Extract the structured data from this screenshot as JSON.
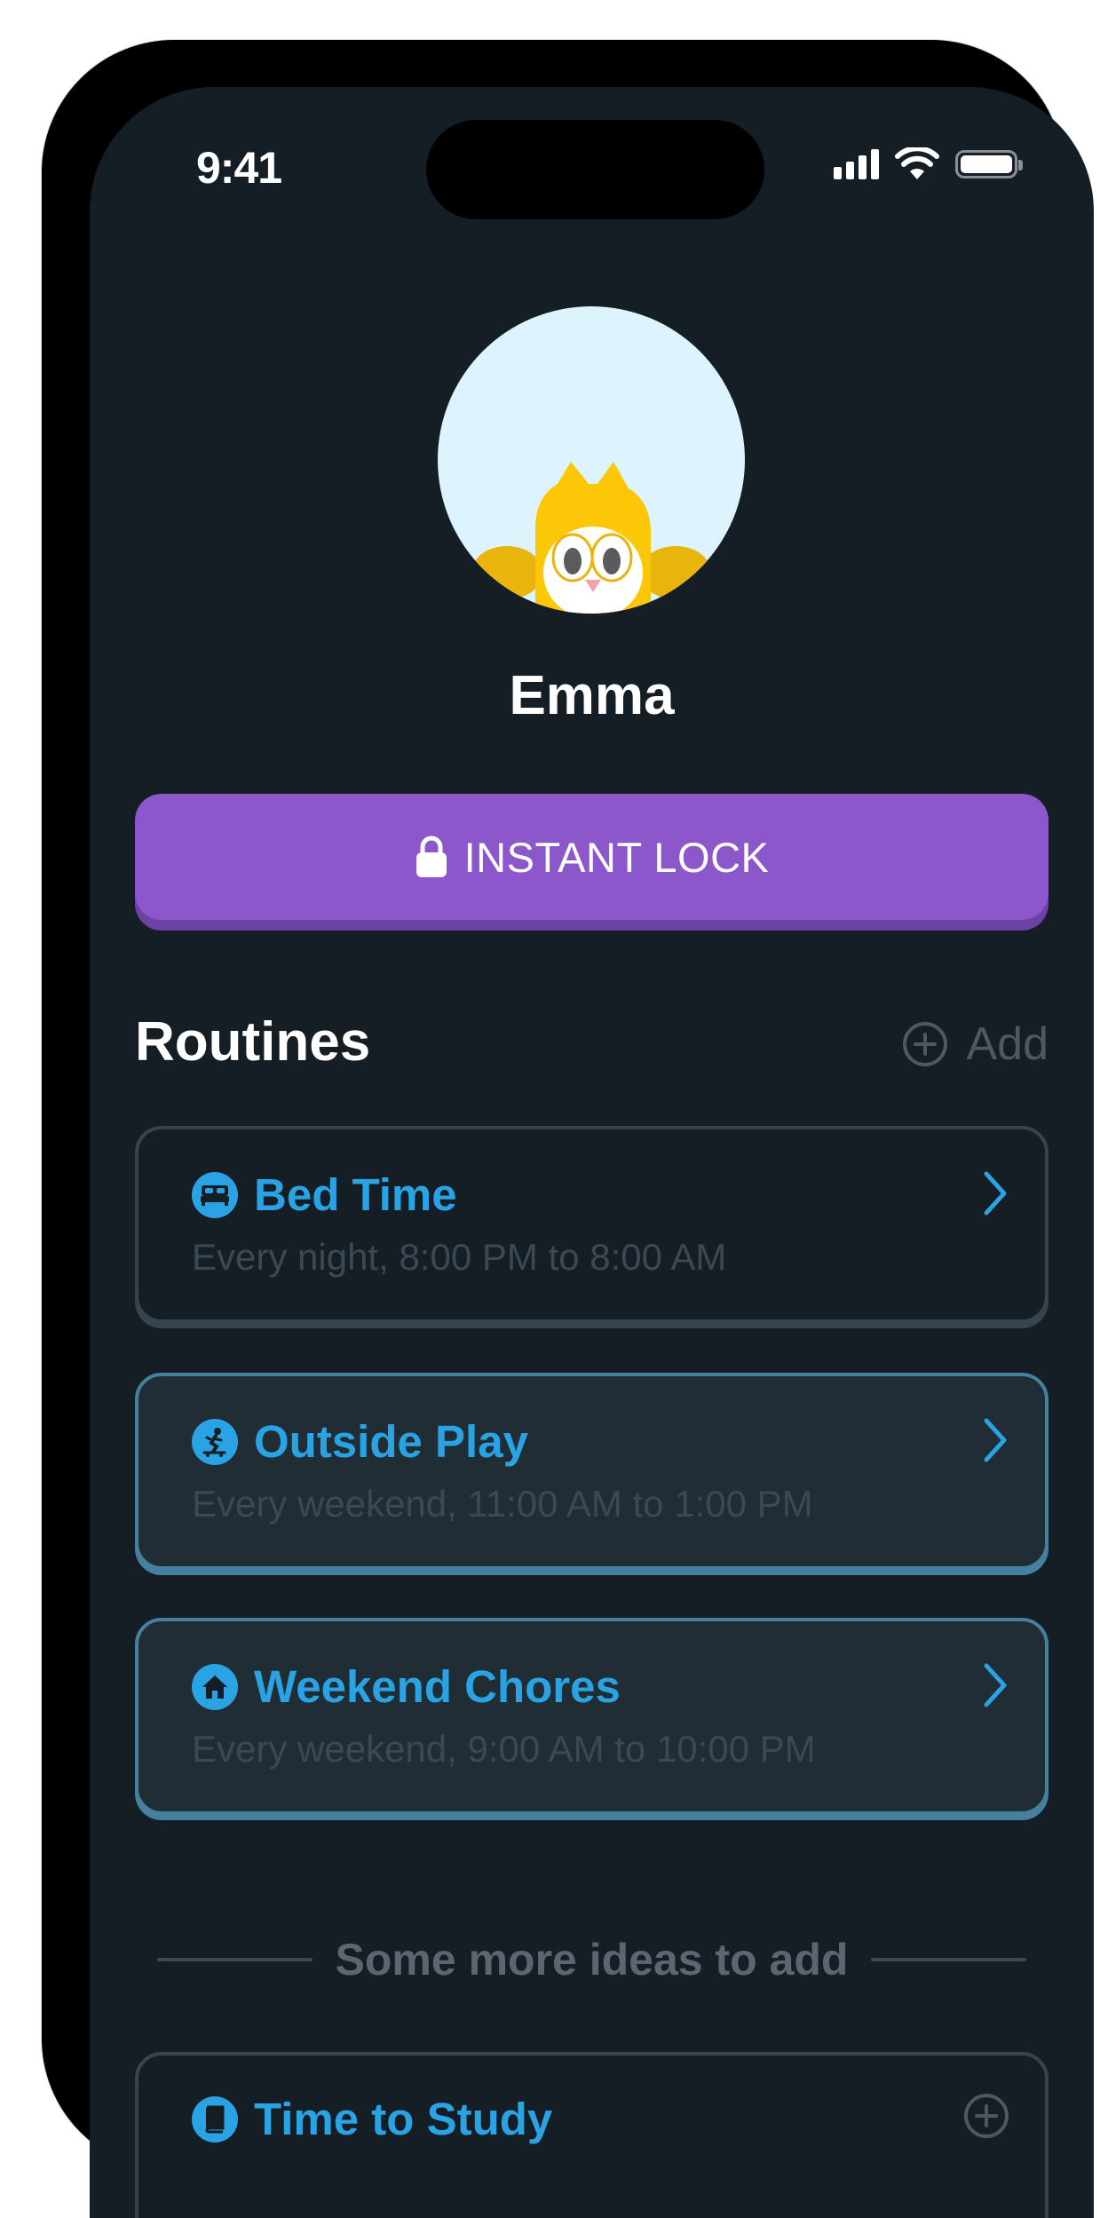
{
  "status_bar": {
    "time": "9:41"
  },
  "profile": {
    "name": "Emma",
    "avatar_icon": "cat-mascot-icon"
  },
  "instant_lock": {
    "label": "INSTANT LOCK",
    "icon": "lock-icon",
    "color": "#8b57cb"
  },
  "routines": {
    "title": "Routines",
    "add_label": "Add",
    "items": [
      {
        "title": "Bed Time",
        "schedule": "Every night, 8:00 PM to 8:00 AM",
        "icon": "bed-icon",
        "highlighted": false
      },
      {
        "title": "Outside Play",
        "schedule": "Every weekend, 11:00 AM to 1:00 PM",
        "icon": "skateboard-icon",
        "highlighted": true
      },
      {
        "title": "Weekend Chores",
        "schedule": "Every weekend, 9:00 AM to 10:00 PM",
        "icon": "home-icon",
        "highlighted": true
      }
    ]
  },
  "ideas": {
    "divider_label": "Some more ideas to add",
    "items": [
      {
        "title": "Time to Study",
        "icon": "book-icon"
      }
    ]
  },
  "colors": {
    "background": "#161e25",
    "accent_blue": "#2aa3e4",
    "highlight_border": "#46809f"
  }
}
